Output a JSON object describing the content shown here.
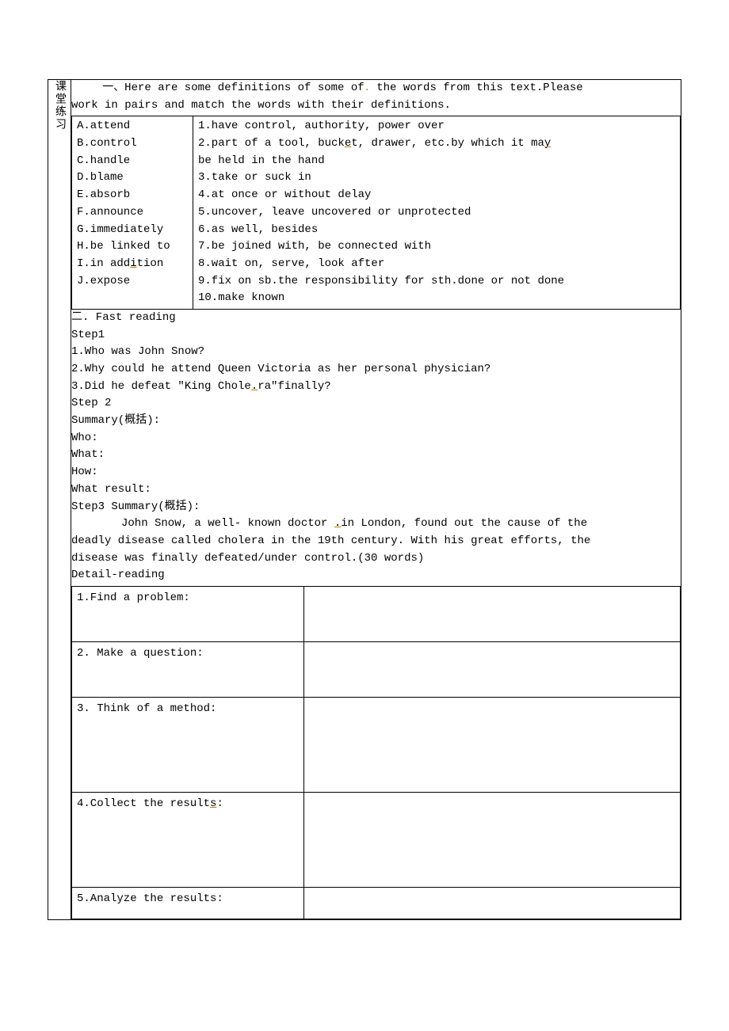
{
  "leftLabel": "课堂练习",
  "intro_line1_a": "一、Here are some definitions of some of",
  "intro_line1_b": " the words from this text.Please",
  "intro_line2": "work in pairs and match the words with their definitions.",
  "vocab": {
    "left": [
      "A.attend",
      "B.control",
      "C.handle",
      "D.blame",
      "E.absorb",
      "F.announce",
      "G.immediately",
      "H.be linked to",
      "I.in addition",
      "J.expose"
    ],
    "right": [
      "1.have control, authority, power over",
      "2.part of a tool, bucket, drawer, etc.by which it may",
      "be held in the hand",
      "3.take or suck in",
      "4.at once or without delay",
      "5.uncover, leave uncovered or unprotected",
      "6.as well, besides",
      "7.be joined with, be connected with",
      "8.wait on, serve, look after",
      "9.fix on sb.the responsibility for sth.done or not done",
      "10.make known"
    ]
  },
  "section2_header": "二. Fast reading",
  "step1_label": "Step1",
  "q1": "1.Who was John Snow?",
  "q2": "2.Why could he attend Queen Victoria as  her personal physician?",
  "q3_a": "3.Did he defeat \"King Chole",
  "q3_b": "ra\"finally?",
  "step2_label": "Step 2",
  "summary_heading": "Summary(概括):",
  "who": "Who:",
  "what": "What:",
  "how": "How:",
  "whatresult": "What result:",
  "step3_label": "Step3 Summary(概括):",
  "summary_text_a": "John Snow, a well- known doctor ",
  "summary_text_b": "in London, found out the cause of the",
  "summary_text_2": "deadly disease called cholera in the 19th century. With his great efforts, the",
  "summary_text_3": "disease was finally defeated/under control.(30 words)",
  "detail_heading": "Detail-reading",
  "detail_rows": [
    "1.Find a problem:",
    "2. Make a question:",
    "3. Think of a method:",
    "4.Collect the results:",
    "5.Analyze the results:"
  ]
}
